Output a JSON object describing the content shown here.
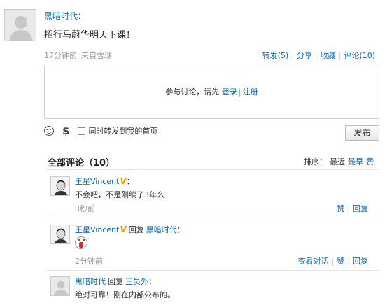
{
  "post": {
    "author": "黑暗时代",
    "colon": "：",
    "text": "招行马蔚华明天下课！",
    "time": "17分钟前",
    "source": "来自雪球",
    "actions": {
      "repost": "转发(5)",
      "share": "分享",
      "favorite": "收藏",
      "comment": "评论(10)"
    }
  },
  "comment_box": {
    "prompt_prefix": "参与讨论，请先",
    "login": "登录",
    "separator": "|",
    "register": "注册"
  },
  "toolbar": {
    "emoji_icon": "smile-icon",
    "money_icon": "dollar-icon",
    "dollar_glyph": "$",
    "repost_label": "同时转发到我的首页",
    "publish_label": "发布"
  },
  "comments_header": {
    "title": "全部评论（10）",
    "sort_label": "排序：",
    "sort_recent": "最近",
    "sort_earliest": "最早",
    "sort_likes": "赞"
  },
  "comments": [
    {
      "author": "王星Vincent",
      "verified_badge": "V",
      "colon": "：",
      "text": "不会吧，不是刚续了3年么",
      "time": "3秒前",
      "like": "赞",
      "reply": "回复"
    },
    {
      "author": "王星Vincent",
      "verified_badge": "V",
      "reply_word": "回复",
      "reply_to": "黑暗时代",
      "colon": "：",
      "sticker_icon": "sticker-icon",
      "time": "2分钟前",
      "view_conversation": "查看对话",
      "like": "赞",
      "reply": "回复"
    },
    {
      "author": "黑暗时代",
      "reply_word": "回复",
      "reply_to": "王员外",
      "colon": "：",
      "text": "绝对可靠！刚在内部公布的。"
    }
  ],
  "colors": {
    "link": "#0a67b3",
    "muted": "#999999",
    "verified_badge": "#f29a00"
  }
}
